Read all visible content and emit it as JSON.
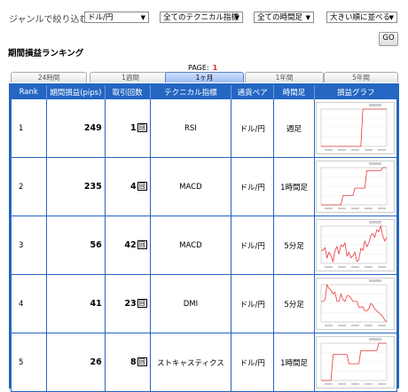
{
  "filter": {
    "label": "ジャンルで絞り込む:",
    "pair": "ドル/円",
    "technical": "全てのテクニカル指標",
    "timeframe": "全ての時間足",
    "sort": "大きい順に並べる",
    "go": "GO"
  },
  "section_title": "期間損益ランキング",
  "page": {
    "label": "PAGE:",
    "number": "1"
  },
  "tabs": [
    "24時間",
    "1週間",
    "1ヶ月",
    "1年間",
    "5年間"
  ],
  "active_tab_index": 2,
  "columns": [
    "Rank",
    "期間損益(pips)",
    "取引回数",
    "テクニカル指標",
    "通貨ペア",
    "時間足",
    "損益グラフ"
  ],
  "trade_unit": "回",
  "rows": [
    {
      "rank": "1",
      "pips": "249",
      "trades": "1",
      "technical": "RSI",
      "pair": "ドル/円",
      "timeframe": "週足",
      "graph": [
        0,
        0,
        0,
        0,
        0,
        0,
        0,
        0,
        0,
        0,
        0,
        0,
        0,
        0,
        0,
        0,
        0,
        0,
        0,
        0,
        0,
        1,
        1,
        1,
        1,
        1,
        1,
        1,
        1,
        1,
        1,
        1,
        1,
        1
      ]
    },
    {
      "rank": "2",
      "pips": "235",
      "trades": "4",
      "technical": "MACD",
      "pair": "ドル/円",
      "timeframe": "1時間足",
      "graph": [
        0,
        0,
        0,
        0,
        0,
        0,
        0,
        0,
        0,
        0,
        0,
        0.25,
        0.25,
        0.25,
        0.25,
        0.25,
        0.25,
        0.45,
        0.45,
        0.45,
        0.45,
        0.45,
        0.45,
        0.92,
        0.92,
        0.92,
        0.92,
        0.92,
        0.92,
        0.92,
        0.92,
        1,
        1,
        1
      ]
    },
    {
      "rank": "3",
      "pips": "56",
      "trades": "42",
      "technical": "MACD",
      "pair": "ドル/円",
      "timeframe": "5分足",
      "graph": [
        0.35,
        0.35,
        0.42,
        0.15,
        0.3,
        0.2,
        0.05,
        0.35,
        0.45,
        0.25,
        0.5,
        0.45,
        0.55,
        0.2,
        0.3,
        0.15,
        0.2,
        0.3,
        0.05,
        0.1,
        0.4,
        0.35,
        0.6,
        0.45,
        0.55,
        0.75,
        0.8,
        0.7,
        0.9,
        0.85,
        1,
        0.75,
        0.6,
        0.7
      ]
    },
    {
      "rank": "4",
      "pips": "41",
      "trades": "23",
      "technical": "DMI",
      "pair": "ドル/円",
      "timeframe": "5分足",
      "graph": [
        0.55,
        0.55,
        0.6,
        1,
        0.9,
        0.85,
        0.75,
        0.8,
        0.55,
        0.55,
        0.75,
        0.6,
        0.55,
        0.7,
        0.7,
        0.65,
        0.55,
        0.55,
        0.55,
        0.4,
        0.4,
        0.4,
        0.3,
        0.3,
        0.35,
        0.5,
        0.45,
        0.35,
        0.3,
        0.25,
        0.2,
        0.15,
        0.05,
        0
      ]
    },
    {
      "rank": "5",
      "pips": "26",
      "trades": "8",
      "technical": "ストキャスティクス",
      "pair": "ドル/円",
      "timeframe": "1時間足",
      "graph": [
        0,
        0,
        0,
        0,
        0,
        0,
        0.7,
        0.7,
        0.7,
        0.7,
        0.7,
        0.7,
        0.7,
        0.7,
        0.45,
        0.45,
        0.45,
        0.45,
        0.45,
        0.45,
        0.8,
        0.8,
        0.8,
        0.8,
        0.8,
        0.8,
        0.8,
        0.8,
        0.8,
        1,
        1,
        1,
        1,
        1
      ]
    }
  ],
  "colors": {
    "header_bg": "#2466c2",
    "graph_line": "#e83a3a",
    "page_number": "#d22222"
  }
}
